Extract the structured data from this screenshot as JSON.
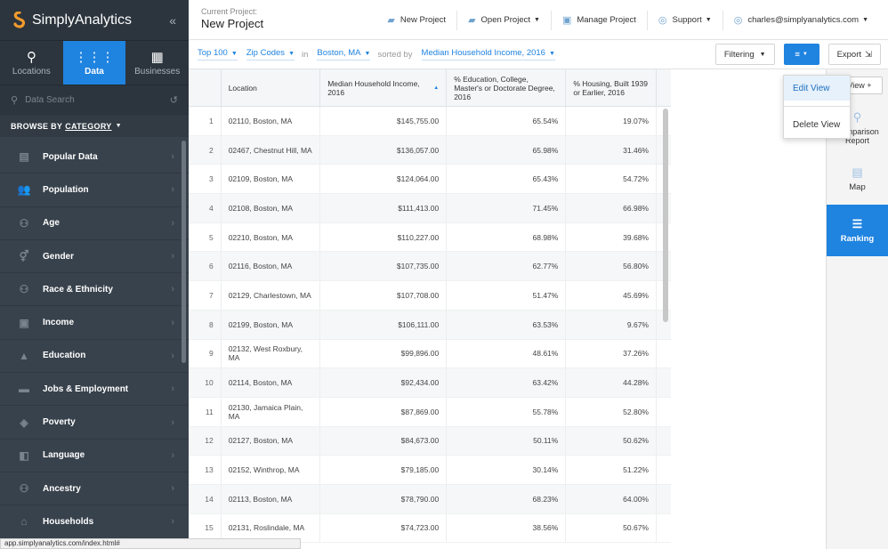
{
  "brand": {
    "name": "SimplyAnalytics",
    "collapse": "«"
  },
  "modes": [
    {
      "label": "Locations",
      "icon": "map-pin-icon",
      "active": false
    },
    {
      "label": "Data",
      "icon": "grid-icon",
      "active": true
    },
    {
      "label": "Businesses",
      "icon": "building-icon",
      "active": false
    }
  ],
  "search": {
    "placeholder": "Data Search"
  },
  "browse": {
    "prefix": "BROWSE BY",
    "category": "CATEGORY"
  },
  "categories": [
    {
      "label": "Popular Data",
      "icon": "popular-data-icon"
    },
    {
      "label": "Population",
      "icon": "population-icon"
    },
    {
      "label": "Age",
      "icon": "age-icon"
    },
    {
      "label": "Gender",
      "icon": "gender-icon"
    },
    {
      "label": "Race & Ethnicity",
      "icon": "race-ethnicity-icon"
    },
    {
      "label": "Income",
      "icon": "income-icon"
    },
    {
      "label": "Education",
      "icon": "education-icon"
    },
    {
      "label": "Jobs & Employment",
      "icon": "jobs-icon"
    },
    {
      "label": "Poverty",
      "icon": "poverty-icon"
    },
    {
      "label": "Language",
      "icon": "language-icon"
    },
    {
      "label": "Ancestry",
      "icon": "ancestry-icon"
    },
    {
      "label": "Households",
      "icon": "households-icon"
    }
  ],
  "status_url": "app.simplyanalytics.com/index.html#",
  "project": {
    "label": "Current Project:",
    "name": "New Project"
  },
  "topnav": {
    "new_project": "New Project",
    "open_project": "Open Project",
    "manage_project": "Manage Project",
    "support": "Support",
    "user": "charles@simplyanalytics.com"
  },
  "toolbar": {
    "top": "Top 100",
    "geo": "Zip Codes",
    "in": "in",
    "location": "Boston, MA",
    "sorted": "sorted by",
    "sort_field": "Median Household Income, 2016",
    "filtering": "Filtering",
    "export": "Export"
  },
  "table": {
    "headers": [
      "",
      "Location",
      "Median Household Income, 2016",
      "% Education, College, Master's or Doctorate Degree, 2016",
      "% Housing, Built 1939 or Earlier, 2016"
    ],
    "sort_indicator": "▲",
    "rows": [
      [
        "1",
        "02110, Boston, MA",
        "$145,755.00",
        "65.54%",
        "19.07%"
      ],
      [
        "2",
        "02467, Chestnut Hill, MA",
        "$136,057.00",
        "65.98%",
        "31.46%"
      ],
      [
        "3",
        "02109, Boston, MA",
        "$124,064.00",
        "65.43%",
        "54.72%"
      ],
      [
        "4",
        "02108, Boston, MA",
        "$111,413.00",
        "71.45%",
        "66.98%"
      ],
      [
        "5",
        "02210, Boston, MA",
        "$110,227.00",
        "68.98%",
        "39.68%"
      ],
      [
        "6",
        "02116, Boston, MA",
        "$107,735.00",
        "62.77%",
        "56.80%"
      ],
      [
        "7",
        "02129, Charlestown, MA",
        "$107,708.00",
        "51.47%",
        "45.69%"
      ],
      [
        "8",
        "02199, Boston, MA",
        "$106,111.00",
        "63.53%",
        "9.67%"
      ],
      [
        "9",
        "02132, West Roxbury, MA",
        "$99,896.00",
        "48.61%",
        "37.26%"
      ],
      [
        "10",
        "02114, Boston, MA",
        "$92,434.00",
        "63.42%",
        "44.28%"
      ],
      [
        "11",
        "02130, Jamaica Plain, MA",
        "$87,869.00",
        "55.78%",
        "52.80%"
      ],
      [
        "12",
        "02127, Boston, MA",
        "$84,673.00",
        "50.11%",
        "50.62%"
      ],
      [
        "13",
        "02152, Winthrop, MA",
        "$79,185.00",
        "30.14%",
        "51.22%"
      ],
      [
        "14",
        "02113, Boston, MA",
        "$78,790.00",
        "68.23%",
        "64.00%"
      ],
      [
        "15",
        "02131, Roslindale, MA",
        "$74,723.00",
        "38.56%",
        "50.67%"
      ]
    ]
  },
  "rpanel": {
    "new_view": "View +",
    "items": [
      {
        "label": "Comparison Report",
        "short": "arison\nReport",
        "icon": "comparison-icon"
      },
      {
        "label": "Map",
        "icon": "map-icon"
      },
      {
        "label": "Ranking",
        "icon": "ranking-icon"
      }
    ]
  },
  "dropdown": {
    "edit": "Edit View",
    "delete": "Delete View"
  },
  "colors": {
    "accent": "#1f83e0",
    "sidebar": "#38424c",
    "sidebar_dark": "#2c353e"
  }
}
